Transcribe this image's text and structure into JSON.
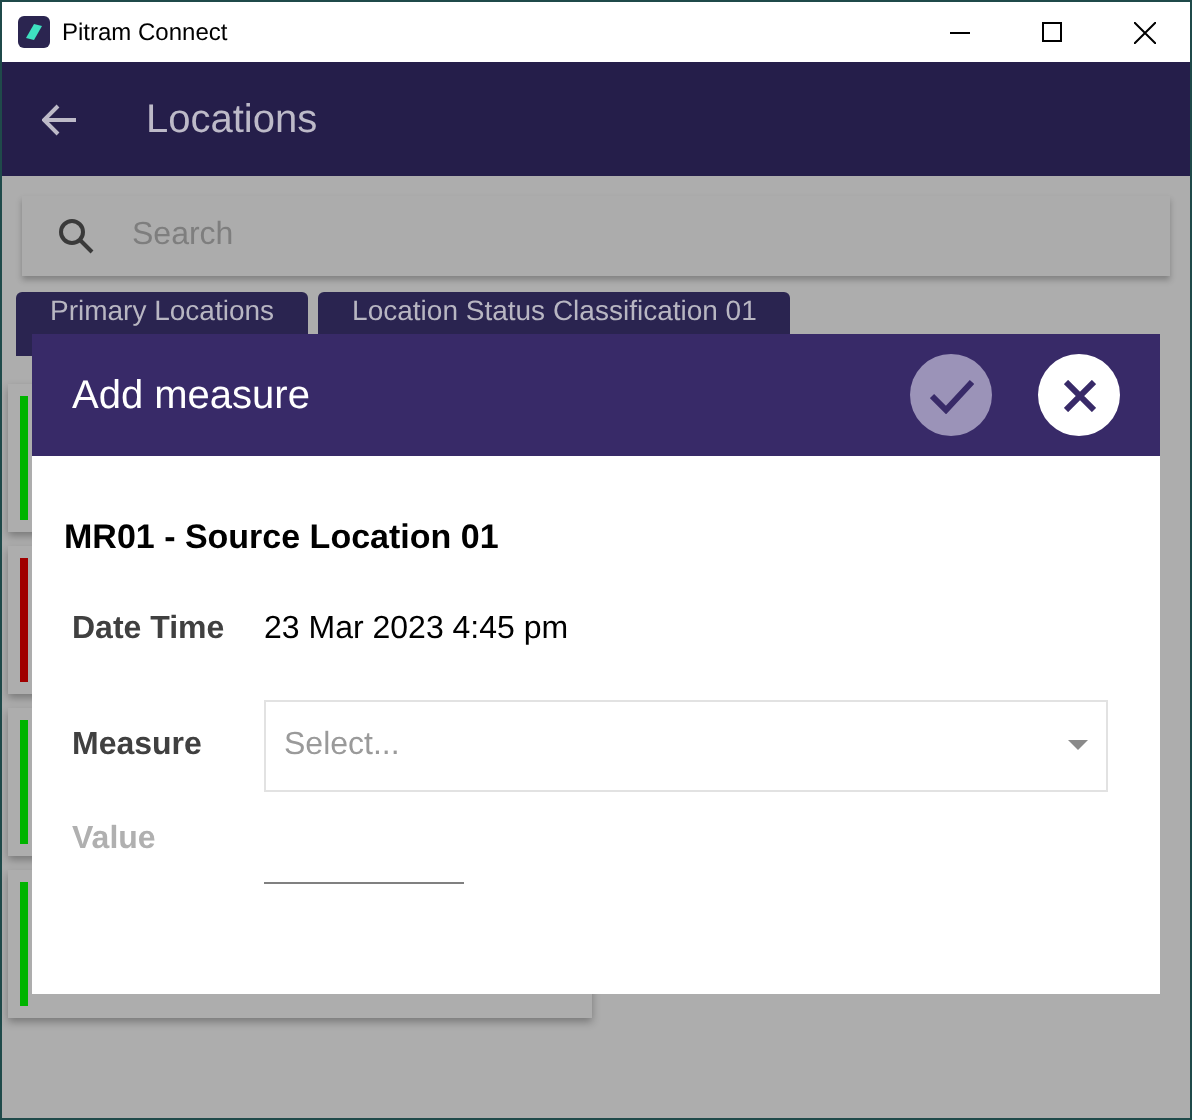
{
  "window": {
    "title": "Pitram Connect"
  },
  "header": {
    "title": "Locations"
  },
  "search": {
    "placeholder": "Search"
  },
  "filters": [
    {
      "label": "Primary Locations"
    },
    {
      "label": "Location Status Classification 01"
    }
  ],
  "cards": [
    {
      "color": "#00b400"
    },
    {
      "color": "#a00000"
    },
    {
      "color": "#00b400"
    },
    {
      "color": "#00b400"
    }
  ],
  "dialog": {
    "title": "Add measure",
    "confirm_disabled": true,
    "location": "MR01 - Source Location 01",
    "fields": [
      {
        "kind": "text",
        "label": "Date Time",
        "value": "23 Mar 2023 4:45 pm",
        "disabled": false
      },
      {
        "kind": "select",
        "label": "Measure",
        "placeholder": "Select...",
        "disabled": false
      },
      {
        "kind": "input",
        "label": "Value",
        "disabled": true
      }
    ]
  }
}
